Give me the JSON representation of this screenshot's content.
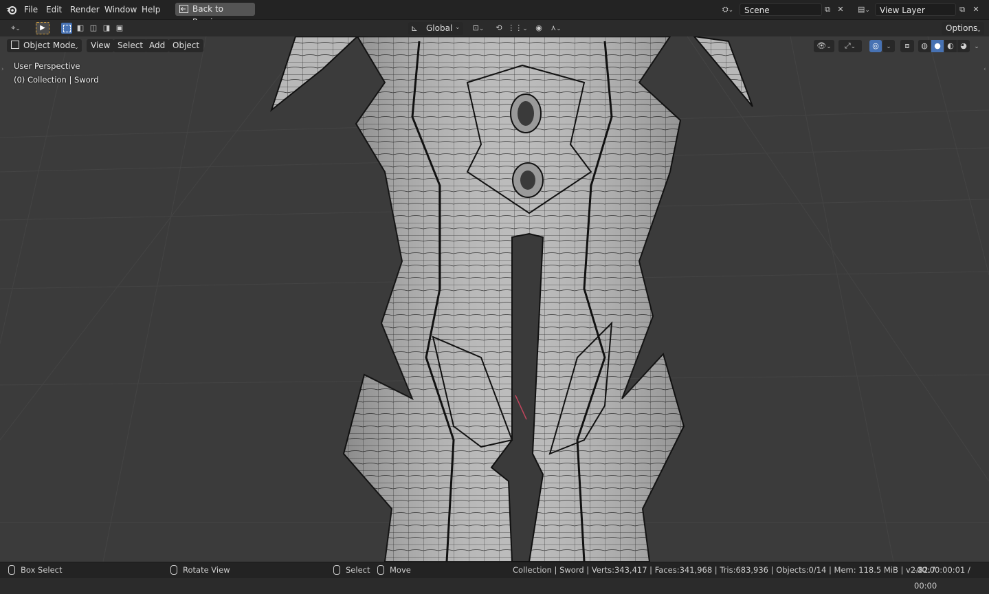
{
  "topbar": {
    "menu": [
      "File",
      "Edit",
      "Render",
      "Window",
      "Help"
    ],
    "back_button": "Back to Previous",
    "scene": "Scene",
    "view_layer": "View Layer"
  },
  "toolbar": {
    "orientation": "Global",
    "options": "Options"
  },
  "viewport_header": {
    "mode": "Object Mode",
    "menus": [
      "View",
      "Select",
      "Add",
      "Object"
    ]
  },
  "overlay": {
    "perspective": "User Perspective",
    "collection": "(0) Collection | Sword"
  },
  "statusbar": {
    "box_select": "Box Select",
    "rotate_view": "Rotate View",
    "select": "Select",
    "move": "Move",
    "stats": "Collection | Sword | Verts:343,417 | Faces:341,968 | Tris:683,936 | Objects:0/14 | Mem: 118.5 MiB | v2.82.7",
    "time": "-00:00:00:01 / 00:00"
  },
  "colors": {
    "accent": "#4772b3",
    "background": "#3a3a3a",
    "header": "#232323",
    "mesh": "#b9b9b9"
  }
}
